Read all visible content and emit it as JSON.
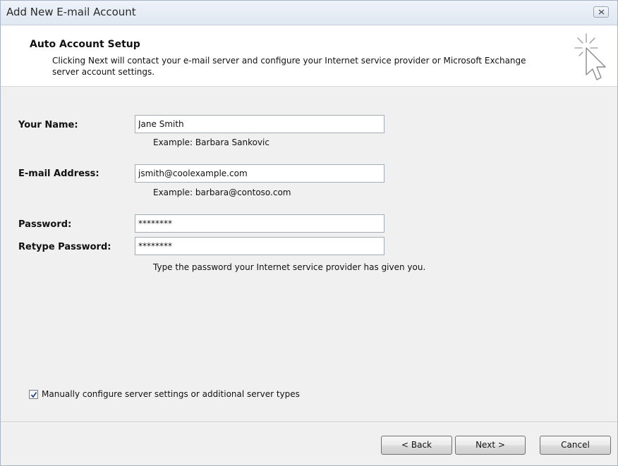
{
  "window": {
    "title": "Add New E-mail Account"
  },
  "header": {
    "title": "Auto Account Setup",
    "description": "Clicking Next will contact your e-mail server and configure your Internet service provider or Microsoft Exchange server account settings."
  },
  "form": {
    "name_label": "Your Name:",
    "name_value": "Jane Smith",
    "name_example": "Example: Barbara Sankovic",
    "email_label": "E-mail Address:",
    "email_value": "jsmith@coolexample.com",
    "email_example": "Example: barbara@contoso.com",
    "password_label": "Password:",
    "password_value": "********",
    "retype_label": "Retype Password:",
    "retype_value": "********",
    "password_hint": "Type the password your Internet service provider has given you."
  },
  "manual_config": {
    "label": "Manually configure server settings or additional server types",
    "checked": true
  },
  "buttons": {
    "back": "< Back",
    "next": "Next >",
    "cancel": "Cancel"
  },
  "icons": {
    "close": "close-icon",
    "setup": "cursor-sparkle-icon",
    "check": "checkmark-icon"
  }
}
